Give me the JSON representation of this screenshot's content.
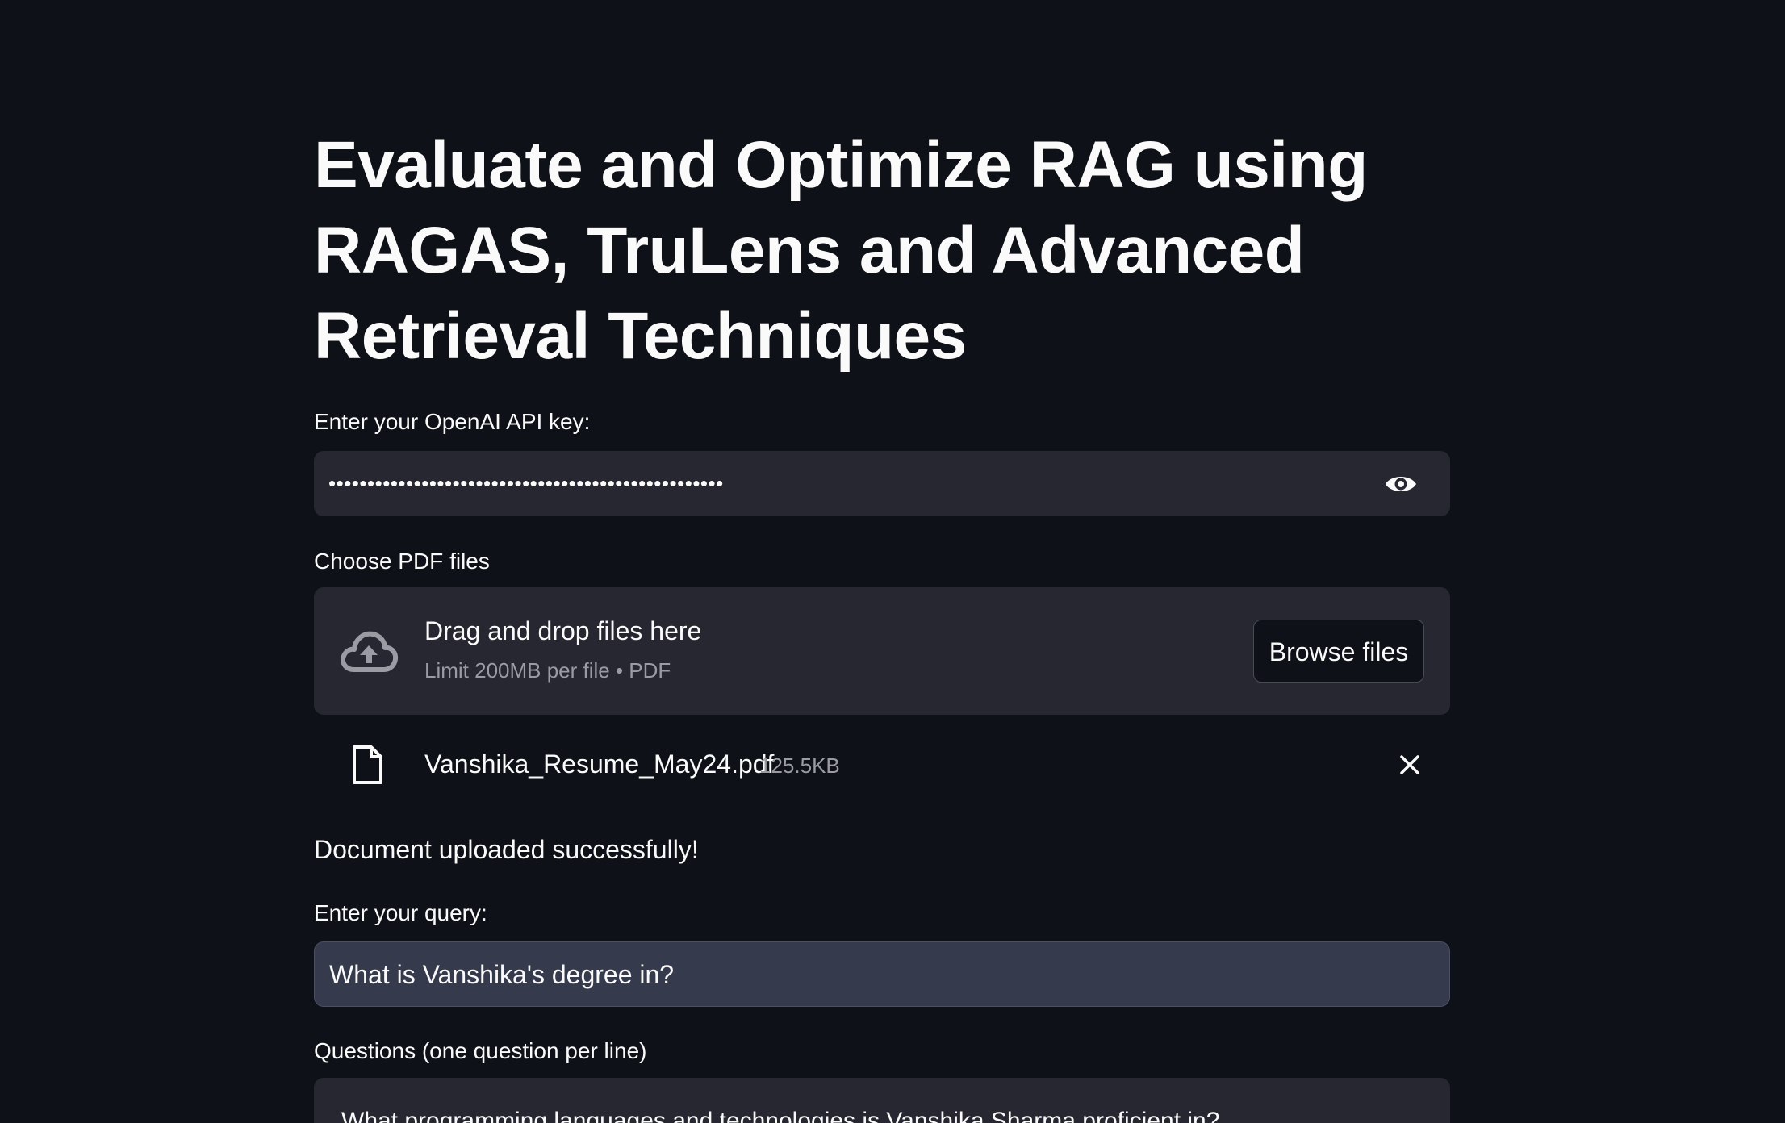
{
  "page": {
    "title": "Evaluate and Optimize RAG using RAGAS, TruLens and Advanced Retrieval Techniques"
  },
  "api_key": {
    "label": "Enter your OpenAI API key:",
    "masked_value": "•••••••••••••••••••••••••••••••••••••••••••••••••••",
    "toggle_icon": "eye-icon"
  },
  "uploader": {
    "label": "Choose PDF files",
    "drop_title": "Drag and drop files here",
    "drop_subtitle": "Limit 200MB per file • PDF",
    "browse_label": "Browse files",
    "icon": "cloud-upload-icon"
  },
  "uploaded_file": {
    "name": "Vanshika_Resume_May24.pdf",
    "size": "125.5KB",
    "icon": "file-icon",
    "remove_icon": "close-icon"
  },
  "status": {
    "message": "Document uploaded successfully!"
  },
  "query": {
    "label": "Enter your query:",
    "value": "What is Vanshika's degree in?"
  },
  "questions": {
    "label": "Questions (one question per line)",
    "first_line": "What programming languages and technologies is Vanshika Sharma proficient in?"
  },
  "colors": {
    "background": "#0e1117",
    "input_background": "#262730",
    "focused_input_background": "#363a4d",
    "muted_text": "#9a9ba3",
    "text": "#fafafa"
  }
}
